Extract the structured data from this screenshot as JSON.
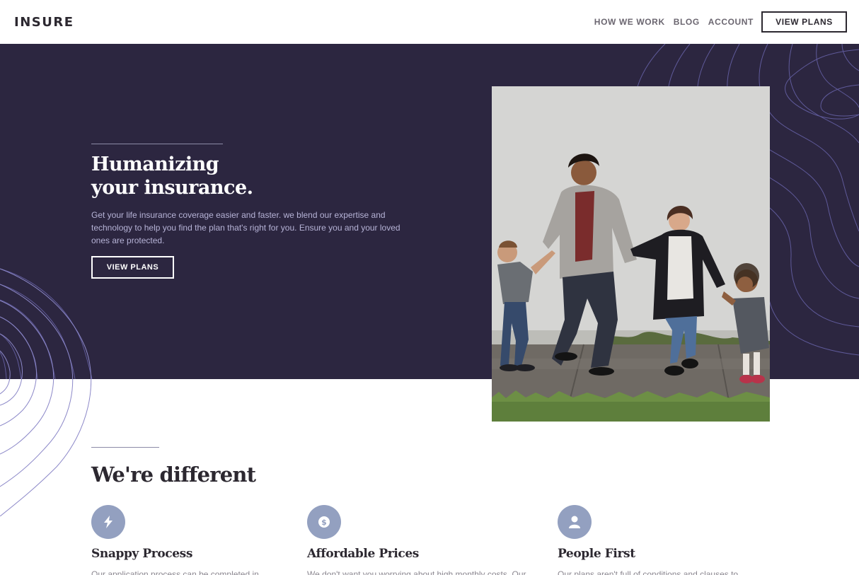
{
  "header": {
    "logo": "INSURE",
    "nav": [
      "HOW WE WORK",
      "BLOG",
      "ACCOUNT"
    ],
    "cta": "VIEW PLANS"
  },
  "hero": {
    "title_line1": "Humanizing",
    "title_line2": "your insurance.",
    "text": "Get your life insurance coverage easier and faster. we blend our expertise and technology to help you find the plan that's right for you. Ensure you and your loved ones are protected.",
    "cta": "VIEW PLANS"
  },
  "different": {
    "title": "We're different",
    "features": [
      {
        "icon": "lightning-icon",
        "title": "Snappy Process",
        "text": "Our application process can be completed in"
      },
      {
        "icon": "dollar-icon",
        "title": "Affordable Prices",
        "text": "We don't want you worrying about high monthly costs. Our"
      },
      {
        "icon": "person-icon",
        "title": "People First",
        "text": "Our plans aren't full of conditions and clauses to"
      }
    ]
  },
  "colors": {
    "hero_bg": "#2c2640",
    "accent": "#93a0c0",
    "text_dark": "#2c2830"
  }
}
